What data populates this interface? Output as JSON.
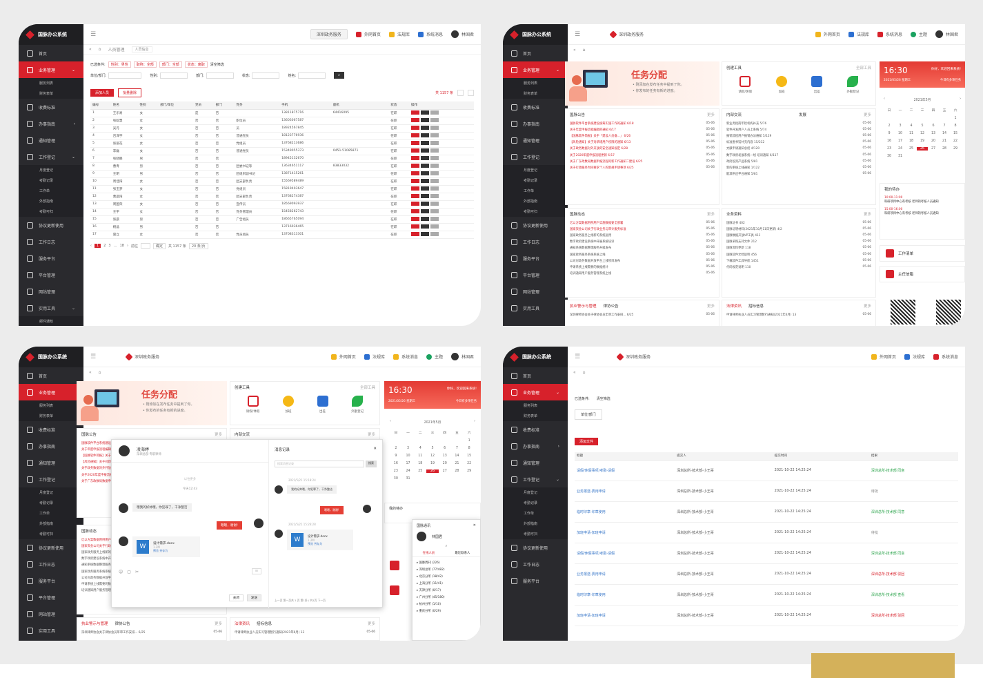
{
  "brand": "国脉办公系统",
  "sidebar": {
    "items": [
      "首页",
      "业务管理",
      "收费标准",
      "办事指南",
      "通知管理",
      "工作登记",
      "协议更新使用",
      "工作日志",
      "服务平台",
      "平台管理",
      "网站管理",
      "实用工具"
    ],
    "p1_subitems": [
      "服务列表",
      "财务表单"
    ],
    "work_subitems": [
      "月度登记",
      "考勤记录",
      "工作单",
      "外部指南",
      "考勤可扫"
    ],
    "tools_sub": [
      "邮件通知"
    ]
  },
  "topbar": {
    "pill": "深圳政务服务",
    "links": [
      "外网首页",
      "法规库",
      "系统消息",
      "主题"
    ],
    "user": "林国君"
  },
  "crumb": {
    "home": "人员管理",
    "tag": "人员信息"
  },
  "p1": {
    "filter_label": "已选条件:",
    "chips": [
      "性别：男性",
      "职称：全部",
      "部门：全部",
      "状态：离职"
    ],
    "clear": "清空筛选",
    "fields": [
      "单位/部门:",
      "性别:",
      "部门:",
      "状态:",
      "姓名:"
    ],
    "btn_add": "添加人员",
    "btn_export": "批量删除",
    "total": "共 1157 条",
    "columns": [
      "编号",
      "姓名",
      "性别",
      "部门/单位",
      "党员",
      "部门",
      "党务",
      "手机",
      "座机",
      "状态",
      "操作"
    ],
    "rows": [
      [
        "1",
        "王乐易",
        "女",
        "",
        "是",
        "否",
        "",
        "13811875716",
        "64416095",
        "在职"
      ],
      [
        "2",
        "张聪慧",
        "女",
        "",
        "否",
        "否",
        "职位员",
        "13603067587",
        "",
        "在职"
      ],
      [
        "3",
        "吴丹",
        "女",
        "",
        "否",
        "否",
        "员",
        "18924567845",
        "",
        "在职"
      ],
      [
        "4",
        "吕泽宇",
        "女",
        "",
        "否",
        "否",
        "普通党员",
        "18123776936",
        "",
        "在职"
      ],
      [
        "5",
        "张丽花",
        "女",
        "",
        "否",
        "否",
        "党组员",
        "13768213686",
        "",
        "在职"
      ],
      [
        "6",
        "李磊",
        "女",
        "",
        "否",
        "否",
        "普通党员",
        "15349055373",
        "0451-51085871",
        "在职"
      ],
      [
        "7",
        "张晓鹏",
        "男",
        "",
        "否",
        "否",
        "",
        "18945132670",
        "",
        "在职"
      ],
      [
        "8",
        "曹青",
        "男",
        "",
        "否",
        "否",
        "团委书记等",
        "13634651117",
        "83833032",
        "在职"
      ],
      [
        "9",
        "王明",
        "男",
        "",
        "否",
        "否",
        "团组织副书记",
        "13871415261",
        "",
        "在职"
      ],
      [
        "10",
        "周佳阳",
        "女",
        "",
        "否",
        "否",
        "团支部负责",
        "15569589489",
        "",
        "在职"
      ],
      [
        "11",
        "张玉梦",
        "女",
        "",
        "否",
        "否",
        "党组员",
        "15819403647",
        "",
        "在职"
      ],
      [
        "12",
        "曹晨阳",
        "女",
        "",
        "否",
        "否",
        "团支部负责",
        "13768274387",
        "",
        "在职"
      ],
      [
        "13",
        "周国荣",
        "女",
        "",
        "否",
        "否",
        "宣传员",
        "18569093937",
        "",
        "在职"
      ],
      [
        "14",
        "王宇",
        "女",
        "",
        "否",
        "否",
        "党务管理员",
        "15458262743",
        "",
        "在职"
      ],
      [
        "15",
        "张晨",
        "男",
        "",
        "否",
        "否",
        "广告组员",
        "18665765094",
        "",
        "在职"
      ],
      [
        "16",
        "杨晶",
        "男",
        "",
        "否",
        "否",
        "",
        "13716036465",
        "",
        "在职"
      ],
      [
        "17",
        "雷立",
        "女",
        "",
        "否",
        "否",
        "党员组员",
        "13708313301",
        "",
        "在职"
      ]
    ],
    "ops": [
      "删除",
      "编辑",
      "查看"
    ],
    "pager": {
      "pages": [
        "1",
        "2",
        "3",
        "…",
        "18"
      ],
      "jump": "前往",
      "go": "确定",
      "total": "共 1157 条",
      "size": "20 条/页"
    }
  },
  "home": {
    "banner_title": "任务分配",
    "banner_desc": [
      "• 刚添加在发布任务中提到了你。",
      "• 你发布的任务有新的进度。"
    ],
    "tools_title": "创建工具",
    "tools_more": "全部工具",
    "tools": [
      "请假/休假",
      "加班",
      "出差",
      "外勤登记"
    ],
    "clock": {
      "time": "16:30",
      "date": "2021/05/26 星期三",
      "greet": "你好，欢迎回来系统!",
      "note": "今日有多项任务"
    },
    "calendar": {
      "month": "2021年5月",
      "weekdays": [
        "日",
        "一",
        "二",
        "三",
        "四",
        "五",
        "六"
      ],
      "days": [
        "",
        "",
        "",
        "",
        "",
        "",
        "1",
        "2",
        "3",
        "4",
        "5",
        "6",
        "7",
        "8",
        "9",
        "10",
        "11",
        "12",
        "13",
        "14",
        "15",
        "16",
        "17",
        "18",
        "19",
        "20",
        "21",
        "22",
        "23",
        "24",
        "25",
        "26",
        "27",
        "28",
        "29",
        "30",
        "31"
      ],
      "selected": "26"
    },
    "notice": {
      "title": "国脉公告",
      "more": "更多",
      "items": [
        "国脉软件平台系统建设统筹实施工作的通知 6/18",
        "关于年度申报流程编辑的通知 6/17",
        "【国脉软件简报】关于「建设人员备...」 6/26",
        "【风险通知】关于对新增用户权限的通知 6/13",
        "关于政务数据对外开放的安全通知规定 6/28",
        "关于2020年度申报流程更新 6/17",
        "关于广东政数局数据申报流程的新工作通知二建设 6/25",
        "关于行政服务时间要求个人的新规申请事项 6/25"
      ],
      "date": "05-06"
    },
    "internal": {
      "title": "内部交流",
      "tab": "发展",
      "more": "更多",
      "items": [
        "新业务指南年检机构补充 5/76",
        "软件开发用户人员上系统 5/74",
        "报销流程用户报销办法通知 5/129",
        "标准图书馆补充内容 15/212",
        "文献申请通知总结 4/120",
        "数字政府发展系统一线 培训通知 6/117",
        "政府投资产品系统 5/81",
        "新的系统上线通知 1/122",
        "能源供应平台通知 5/81"
      ]
    },
    "schedule": {
      "title": "我的待办",
      "items": [
        {
          "time": "10:00-11:00",
          "text": "科研项目中心有考核 老师的考核人员通知"
        },
        {
          "time": "15:00-16:00",
          "text": "科研项目中心有考核 老师的考核人员通知"
        }
      ]
    },
    "quick": [
      "工作清单",
      "主任信箱"
    ],
    "news": {
      "title": "国脉动态",
      "more": "更多",
      "items": [
        "亿以方案数据用例用户实施数据安全部署",
        "国家资金公司关于行政业务与审计服务标准",
        "国家政务服务上线新的系统运用",
        "数字政府建设系统中开展系统培训",
        "通知系统数据整理服务升级发布",
        "国家政务服务系统系统上线",
        "公司对政务数据开放平台上线项目发布",
        "申请系统上线需要的数据统计",
        "培训通知用户服务管理系统上线"
      ]
    },
    "biz": {
      "title": "业务资料",
      "more": "更多",
      "items": [
        "国脉证书 402",
        "国脉证明材料(2021年10月11日更新) 4/2",
        "国脉数据开放VP工具 411",
        "国脉采购支持文件 212",
        "国脉资料更新 118",
        "国脉软件文档说明 456",
        "下载软件工具导航 1451",
        "代码规范说明 110"
      ]
    },
    "bottom_tabs_left": [
      "执业警示与管理",
      "律协公告"
    ],
    "bottom_tabs_right": [
      "法律资讯",
      "招标信息"
    ],
    "bottom_left_item": "深圳律师协会关于律协会员年审工作安排... 6/25",
    "bottom_right_item": "申请律师执业人员实习管理暂行通知(2021年6月) 13"
  },
  "chat": {
    "name": "凌海婷",
    "dept": "深圳总部·专职律师",
    "date_label": "以往更多",
    "time_label": "今天12:43",
    "msg1": "哦我的好帅哦，你犯罪了，干净整洁",
    "msg2": "嗯嗯，谢谢!",
    "file_name": "设计需求.docx",
    "file_size": "1.2M",
    "file_ops": [
      "预览",
      "另存为"
    ],
    "send": "发送",
    "close": "关闭",
    "history_title": "消息记录",
    "search_placeholder": "搜索消息记录",
    "search_btn": "搜索",
    "history_time1": "2021/5/21 15:18:24",
    "history_msg1": "我的好帅哦，你犯罪了，干净整洁",
    "history_msg2": "嗯嗯，谢谢!",
    "history_time2": "2021/5/21 15:26:28",
    "history_pager": "上一页 第一页共 1 页 第1条 / 共1页 下一页",
    "contacts": {
      "title": "国脉通讯",
      "me": "林国君",
      "tabs": [
        "在线人员",
        "最近联系人"
      ],
      "groups": [
        "国脉周刊 (226)",
        "深圳总所 (77/482)",
        "北京分所 (18/42)",
        "上海分所 (11/41)",
        "天津分所 (0/17)",
        "广州分所 (45/180)",
        "杭州分所 (1/10)",
        "重庆分所 (0/29)"
      ]
    }
  },
  "p4": {
    "filter_label": "已选条件:",
    "clear": "清空筛选",
    "unit": "单位/部门",
    "add": "添加文件",
    "columns": [
      "标题",
      "提交人",
      "提交时间",
      "结果"
    ],
    "rows": [
      {
        "title": "请假/休假事项/考勤-请假",
        "who": "深圳总所-技术部-小王哥",
        "time": "2021-10-22  14:25:24",
        "result": "深圳总所-技术部  同意",
        "cls": "green"
      },
      {
        "title": "业务报送-费用申请",
        "who": "深圳总所-技术部-小王哥",
        "time": "2021-10-22  14:25:24",
        "result": "待批",
        "cls": "gray"
      },
      {
        "title": "临时印章-印章使用",
        "who": "深圳总所-技术部-小王哥",
        "time": "2021-10-22  14:25:24",
        "result": "深圳总所-技术部  同意",
        "cls": "green"
      },
      {
        "title": "加班申请-加班申请",
        "who": "深圳总所-技术部-小王哥",
        "time": "2021-10-22  14:25:24",
        "result": "待批",
        "cls": "gray"
      },
      {
        "title": "请假/休假事项/考勤-请假",
        "who": "深圳总所-技术部-小王哥",
        "time": "2021-10-22  14:25:24",
        "result": "深圳总所-技术部  同意",
        "cls": "green"
      },
      {
        "title": "业务报送-费用申请",
        "who": "深圳总所-技术部-小王哥",
        "time": "2021-10-22  14:25:24",
        "result": "深圳总所-技术部  驳回",
        "cls": "red"
      },
      {
        "title": "临时印章-印章使用",
        "who": "深圳总所-技术部-小王哥",
        "time": "2021-10-22  14:25:24",
        "result": "深圳总所-技术部  查看",
        "cls": "green"
      },
      {
        "title": "加班申请-加班申请",
        "who": "深圳总所-技术部-小王哥",
        "time": "2021-10-22  14:25:24",
        "result": "深圳总所-技术部  驳回",
        "cls": "red"
      }
    ]
  },
  "colors": {
    "accent": "#d7212b",
    "sidebar": "#2a2a2e",
    "gold": "#d4b15a"
  }
}
